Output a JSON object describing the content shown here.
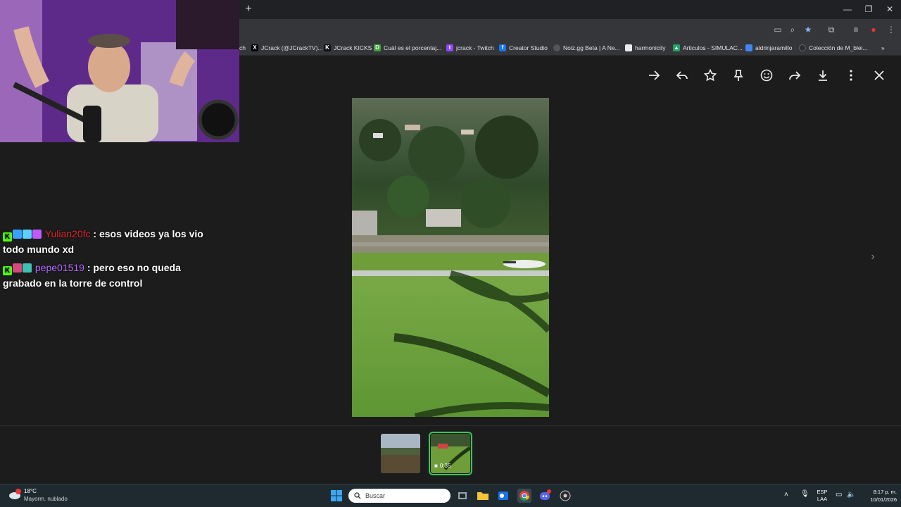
{
  "browser": {
    "new_tab_label": "+",
    "window_controls": {
      "minimize": "—",
      "restore": "❐",
      "close": "✕"
    },
    "bookmarks": [
      {
        "label": "ch",
        "color": "#35363a"
      },
      {
        "label": "JCrack (@JCrackTV)...",
        "color": "#000000",
        "icon": "x-icon"
      },
      {
        "label": "JCrack KICKS",
        "color": "#111111",
        "icon": "kick-icon"
      },
      {
        "label": "Cuál es el porcentaj...",
        "color": "#3fa33b",
        "icon": "doc-icon"
      },
      {
        "label": "jcrack - Twitch",
        "color": "#9146ff",
        "icon": "twitch-icon"
      },
      {
        "label": "Creator Studio",
        "color": "#1877f2",
        "icon": "facebook-icon"
      },
      {
        "label": "Noiz.gg Beta | A Ne...",
        "color": "#35363a",
        "icon": "dot-icon"
      },
      {
        "label": "harmonicity",
        "color": "#e8eaed",
        "icon": "page-icon"
      },
      {
        "label": "Articulos - SIMULAC...",
        "color": "#1fa463",
        "icon": "drive-icon"
      },
      {
        "label": "aldrinjaramillo",
        "color": "#4285f4",
        "icon": "sheet-icon"
      },
      {
        "label": "Colección de M_blei...",
        "color": "#35363a",
        "icon": "globe-icon"
      }
    ],
    "more_bookmarks": "»"
  },
  "viewer": {
    "actions": [
      "forward-icon",
      "reply-icon",
      "star-icon",
      "pin-icon",
      "emoji-icon",
      "share-icon",
      "download-icon",
      "more-icon",
      "close-icon"
    ],
    "next_arrow": "›",
    "video_duration": "0:35"
  },
  "chat": {
    "messages": [
      {
        "user": "Yulian20fc",
        "text": ": esos videos ya los vio todo mundo xd",
        "user_color": "#e0282f"
      },
      {
        "user": "pepe01519",
        "text": ": pero eso no queda grabado en la torre de control",
        "user_color": "#b36bff"
      }
    ]
  },
  "taskbar": {
    "weather": {
      "temp": "18°C",
      "desc": "Mayorm. nublado",
      "alert": "1"
    },
    "search_placeholder": "Buscar",
    "language": "ESP",
    "layout": "LAA",
    "time": "8:17 p. m.",
    "date": "10/01/2026"
  }
}
